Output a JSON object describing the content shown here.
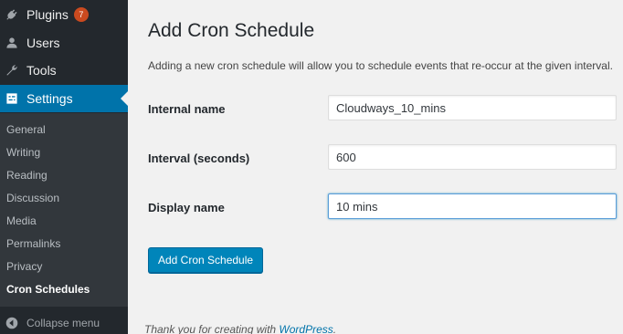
{
  "sidebar": {
    "menu": [
      {
        "label": "Plugins",
        "badge": "7",
        "icon": "plugin-icon"
      },
      {
        "label": "Users",
        "icon": "users-icon"
      },
      {
        "label": "Tools",
        "icon": "tools-icon"
      },
      {
        "label": "Settings",
        "icon": "settings-icon",
        "active": true
      }
    ],
    "submenu": [
      "General",
      "Writing",
      "Reading",
      "Discussion",
      "Media",
      "Permalinks",
      "Privacy",
      "Cron Schedules"
    ],
    "current_submenu": "Cron Schedules",
    "collapse_label": "Collapse menu"
  },
  "main": {
    "title": "Add Cron Schedule",
    "description": "Adding a new cron schedule will allow you to schedule events that re-occur at the given interval.",
    "fields": {
      "internal_name": {
        "label": "Internal name",
        "value": "Cloudways_10_mins"
      },
      "interval": {
        "label": "Interval (seconds)",
        "value": "600"
      },
      "display_name": {
        "label": "Display name",
        "value": "10 mins"
      }
    },
    "submit_label": "Add Cron Schedule"
  },
  "footer": {
    "text": "Thank you for creating with ",
    "link": "WordPress",
    "end": "."
  },
  "colors": {
    "sidebar_bg": "#23282d",
    "submenu_bg": "#32373c",
    "accent": "#0073aa",
    "button": "#0085ba",
    "badge": "#ca4a1f"
  }
}
